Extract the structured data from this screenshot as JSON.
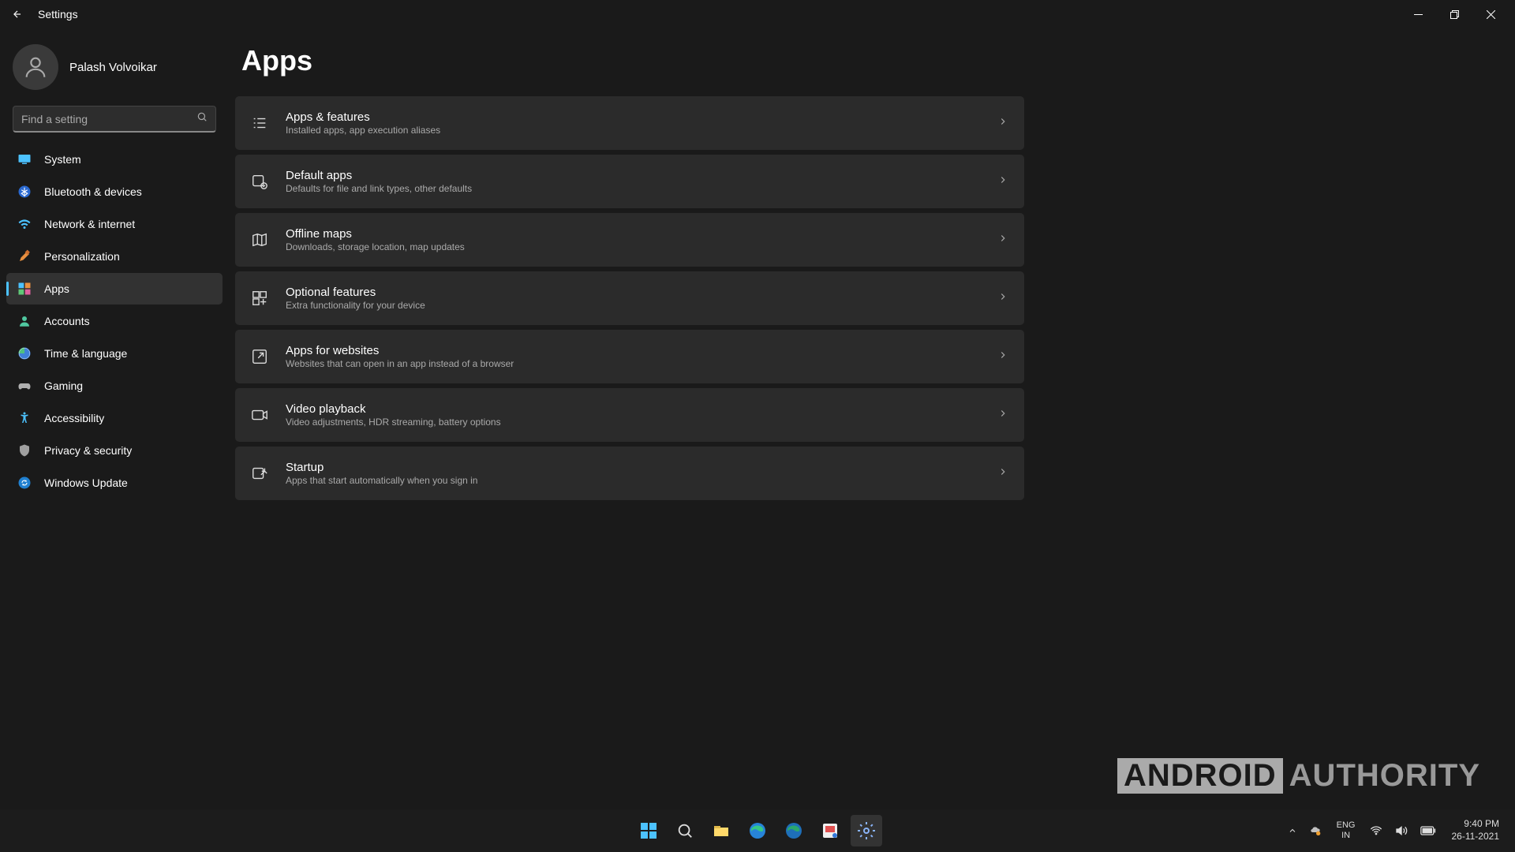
{
  "window": {
    "title": "Settings"
  },
  "user": {
    "name": "Palash Volvoikar"
  },
  "search": {
    "placeholder": "Find a setting"
  },
  "nav": [
    {
      "label": "System",
      "icon": "system",
      "active": false
    },
    {
      "label": "Bluetooth & devices",
      "icon": "bluetooth",
      "active": false
    },
    {
      "label": "Network & internet",
      "icon": "wifi",
      "active": false
    },
    {
      "label": "Personalization",
      "icon": "personalization",
      "active": false
    },
    {
      "label": "Apps",
      "icon": "apps",
      "active": true
    },
    {
      "label": "Accounts",
      "icon": "accounts",
      "active": false
    },
    {
      "label": "Time & language",
      "icon": "time",
      "active": false
    },
    {
      "label": "Gaming",
      "icon": "gaming",
      "active": false
    },
    {
      "label": "Accessibility",
      "icon": "accessibility",
      "active": false
    },
    {
      "label": "Privacy & security",
      "icon": "privacy",
      "active": false
    },
    {
      "label": "Windows Update",
      "icon": "update",
      "active": false
    }
  ],
  "page": {
    "title": "Apps"
  },
  "settings": [
    {
      "title": "Apps & features",
      "subtitle": "Installed apps, app execution aliases",
      "icon": "apps-features"
    },
    {
      "title": "Default apps",
      "subtitle": "Defaults for file and link types, other defaults",
      "icon": "default-apps"
    },
    {
      "title": "Offline maps",
      "subtitle": "Downloads, storage location, map updates",
      "icon": "maps"
    },
    {
      "title": "Optional features",
      "subtitle": "Extra functionality for your device",
      "icon": "optional"
    },
    {
      "title": "Apps for websites",
      "subtitle": "Websites that can open in an app instead of a browser",
      "icon": "websites"
    },
    {
      "title": "Video playback",
      "subtitle": "Video adjustments, HDR streaming, battery options",
      "icon": "video"
    },
    {
      "title": "Startup",
      "subtitle": "Apps that start automatically when you sign in",
      "icon": "startup"
    }
  ],
  "taskbar": {
    "language_primary": "ENG",
    "language_secondary": "IN",
    "time": "9:40 PM",
    "date": "26-11-2021"
  },
  "watermark": {
    "boxed": "ANDROID",
    "text": "AUTHORITY"
  }
}
